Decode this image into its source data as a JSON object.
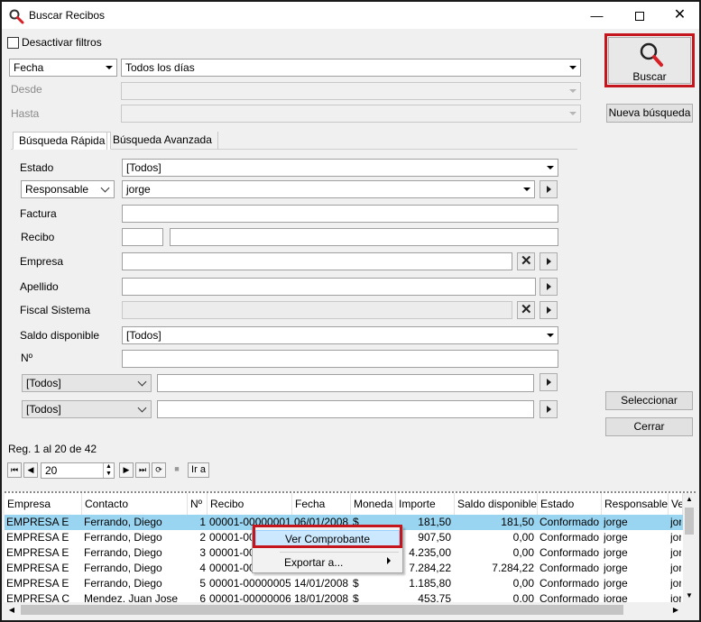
{
  "window": {
    "title": "Buscar Recibos"
  },
  "filters": {
    "deactivate_label": "Desactivar filtros",
    "date_field": "Fecha",
    "date_range": "Todos los días",
    "from_label": "Desde",
    "to_label": "Hasta"
  },
  "buttons": {
    "search": "Buscar",
    "new_search": "Nueva búsqueda",
    "select": "Seleccionar",
    "close": "Cerrar"
  },
  "tabs": [
    "Búsqueda Rápida",
    "Búsqueda Avanzada"
  ],
  "quick": {
    "estado_label": "Estado",
    "estado_value": "[Todos]",
    "responsable_label": "Responsable",
    "responsable_value": "jorge",
    "factura_label": "Factura",
    "recibo_label": "Recibo",
    "empresa_label": "Empresa",
    "apellido_label": "Apellido",
    "fiscal_label": "Fiscal Sistema",
    "saldo_label": "Saldo disponible",
    "saldo_value": "[Todos]",
    "numero_label": "Nº",
    "extra1_value": "[Todos]",
    "extra2_value": "[Todos]"
  },
  "pager": {
    "status": "Reg. 1 al 20 de 42",
    "page_size": "20",
    "goto_label": "Ir a",
    "first_icon": "⏮",
    "prev_icon": "◀",
    "next_icon": "▶",
    "last_icon": "⏭",
    "refresh_icon": "⟳",
    "stop_icon": "■"
  },
  "grid": {
    "columns": [
      "Empresa",
      "Contacto",
      "Nº",
      "Recibo",
      "Fecha",
      "Moneda",
      "Importe",
      "Saldo disponible",
      "Estado",
      "Responsable",
      "Ve"
    ],
    "rows": [
      [
        "EMPRESA E",
        "Ferrando, Diego",
        "1",
        "00001-00000001",
        "06/01/2008",
        "$",
        "181,50",
        "181,50",
        "Conformado",
        "jorge",
        "jor"
      ],
      [
        "EMPRESA E",
        "Ferrando, Diego",
        "2",
        "00001-00",
        "",
        "",
        "907,50",
        "0,00",
        "Conformado",
        "jorge",
        "jor"
      ],
      [
        "EMPRESA E",
        "Ferrando, Diego",
        "3",
        "00001-00",
        "",
        "",
        "4.235,00",
        "0,00",
        "Conformado",
        "jorge",
        "jor"
      ],
      [
        "EMPRESA E",
        "Ferrando, Diego",
        "4",
        "00001-00",
        "",
        "",
        "7.284,22",
        "7.284,22",
        "Conformado",
        "jorge",
        "jor"
      ],
      [
        "EMPRESA E",
        "Ferrando, Diego",
        "5",
        "00001-00000005",
        "14/01/2008",
        "$",
        "1.185,80",
        "0,00",
        "Conformado",
        "jorge",
        "jor"
      ],
      [
        "EMPRESA C",
        "Mendez, Juan Jose",
        "6",
        "00001-00000006",
        "18/01/2008",
        "$",
        "453,75",
        "0,00",
        "Conformado",
        "jorge",
        "jor"
      ]
    ]
  },
  "context_menu": {
    "items": [
      "Ver Comprobante",
      "Exportar a..."
    ]
  },
  "colors": {
    "highlight_red": "#c4161c",
    "selection": "#99d4f0"
  }
}
